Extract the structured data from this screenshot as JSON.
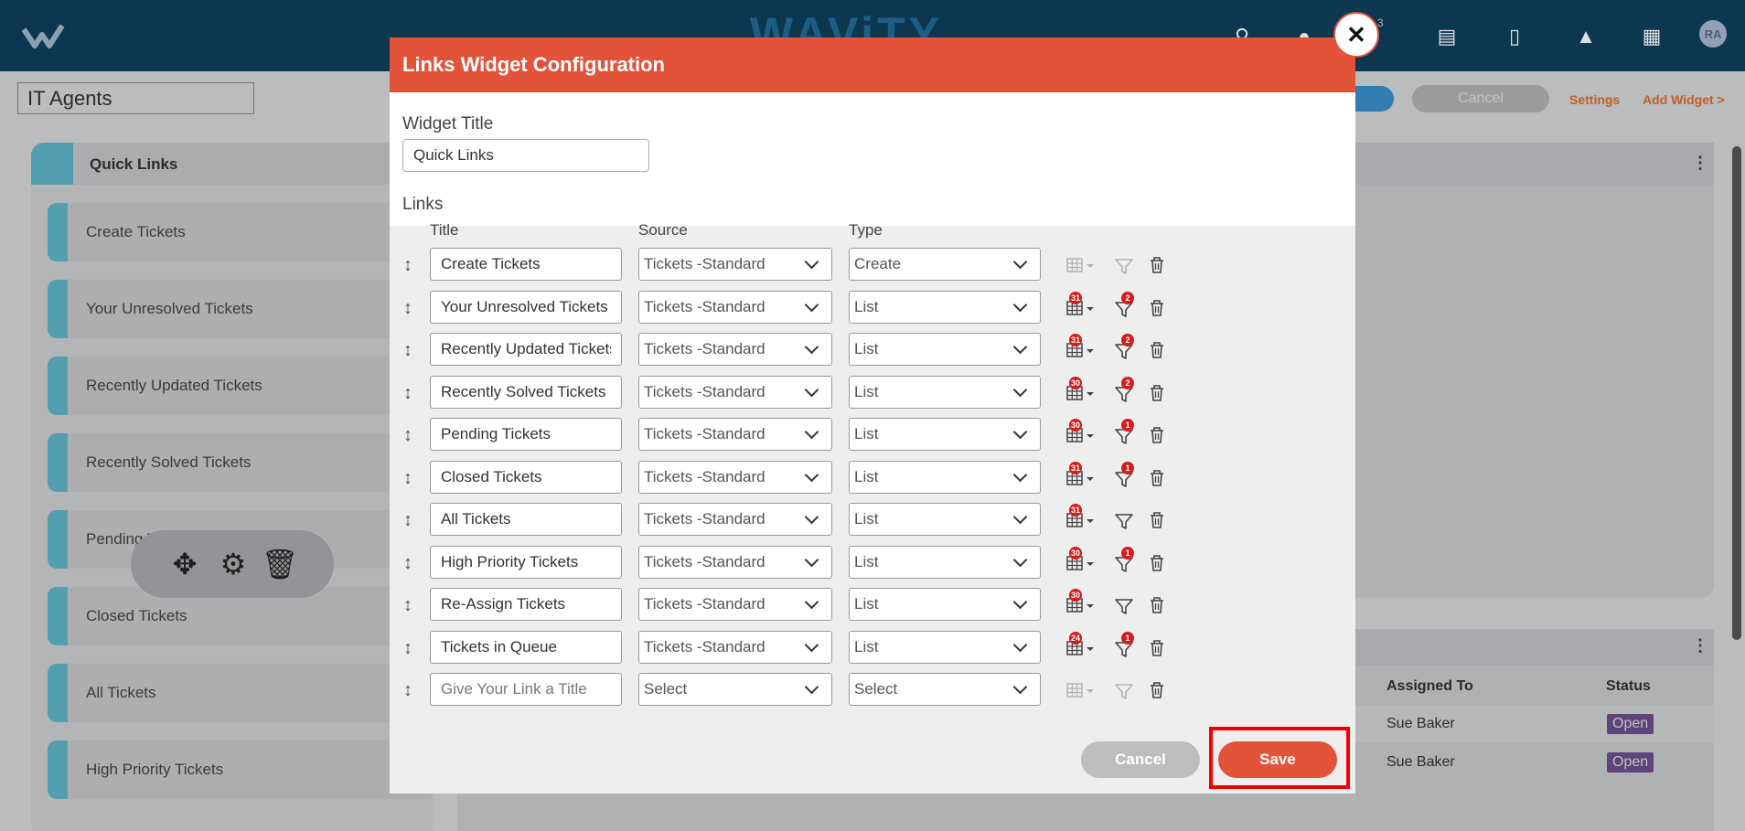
{
  "topbar": {
    "brand": "WAViTY",
    "notification_count": "3",
    "avatar_initials": "RA",
    "icons": [
      "search-icon",
      "chat-icon",
      "notifications-icon",
      "library-icon",
      "feedback-icon",
      "mountain-icon",
      "apps-grid-icon"
    ]
  },
  "toolbar": {
    "dashboard_name": "IT Agents",
    "cancel_label": "Cancel",
    "settings_label": "Settings",
    "add_widget_label": "Add Widget >"
  },
  "quick_links_panel": {
    "title": "Quick Links",
    "items": [
      "Create Tickets",
      "Your Unresolved Tickets",
      "Recently Updated Tickets",
      "Recently Solved Tickets",
      "Pending Tickets",
      "Closed Tickets",
      "All Tickets",
      "High Priority Tickets"
    ],
    "pending_partial": "Pending T"
  },
  "tickets_table": {
    "headers": {
      "assigned_to": "Assigned To",
      "status": "Status"
    },
    "rows": [
      {
        "assigned_to": "Sue Baker",
        "status": "Open"
      },
      {
        "assigned_to": "Sue Baker",
        "status": "Open"
      }
    ]
  },
  "modal": {
    "title": "Links Widget Configuration",
    "widget_title_label": "Widget Title",
    "widget_title_value": "Quick Links",
    "links_label": "Links",
    "col_title": "Title",
    "col_source": "Source",
    "col_type": "Type",
    "rows": [
      {
        "title": "Create Tickets",
        "source": "Tickets -Standard",
        "type": "Create",
        "grid_badge": "",
        "filter_badge": "",
        "disabled": true
      },
      {
        "title": "Your Unresolved Tickets",
        "source": "Tickets -Standard",
        "type": "List",
        "grid_badge": "31",
        "filter_badge": "2",
        "disabled": false
      },
      {
        "title": "Recently Updated Tickets",
        "source": "Tickets -Standard",
        "type": "List",
        "grid_badge": "31",
        "filter_badge": "2",
        "disabled": false
      },
      {
        "title": "Recently Solved Tickets",
        "source": "Tickets -Standard",
        "type": "List",
        "grid_badge": "30",
        "filter_badge": "2",
        "disabled": false
      },
      {
        "title": "Pending Tickets",
        "source": "Tickets -Standard",
        "type": "List",
        "grid_badge": "30",
        "filter_badge": "1",
        "disabled": false
      },
      {
        "title": "Closed Tickets",
        "source": "Tickets -Standard",
        "type": "List",
        "grid_badge": "31",
        "filter_badge": "1",
        "disabled": false
      },
      {
        "title": "All Tickets",
        "source": "Tickets -Standard",
        "type": "List",
        "grid_badge": "31",
        "filter_badge": "",
        "disabled": false
      },
      {
        "title": "High Priority Tickets",
        "source": "Tickets -Standard",
        "type": "List",
        "grid_badge": "30",
        "filter_badge": "1",
        "disabled": false
      },
      {
        "title": "Re-Assign Tickets",
        "source": "Tickets -Standard",
        "type": "List",
        "grid_badge": "30",
        "filter_badge": "",
        "disabled": false
      },
      {
        "title": "Tickets in Queue",
        "source": "Tickets -Standard",
        "type": "List",
        "grid_badge": "24",
        "filter_badge": "1",
        "disabled": false
      }
    ],
    "new_row": {
      "placeholder": "Give Your Link a Title",
      "source": "Select",
      "type": "Select"
    },
    "cancel_label": "Cancel",
    "save_label": "Save"
  },
  "colors": {
    "header_bg": "#0f3f5c",
    "modal_accent": "#e2533a",
    "link_orange": "#e06a2c",
    "tile_accent": "#5fb4c8",
    "highlight_red": "#ee0000"
  }
}
